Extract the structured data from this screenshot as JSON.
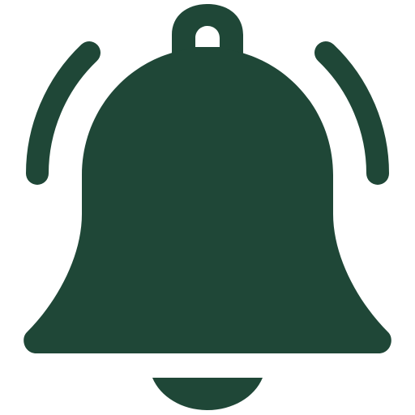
{
  "icon": {
    "name": "notification-bell-icon",
    "fill_color": "#1f4737",
    "background_color": "#ffffff",
    "ringing": true
  }
}
